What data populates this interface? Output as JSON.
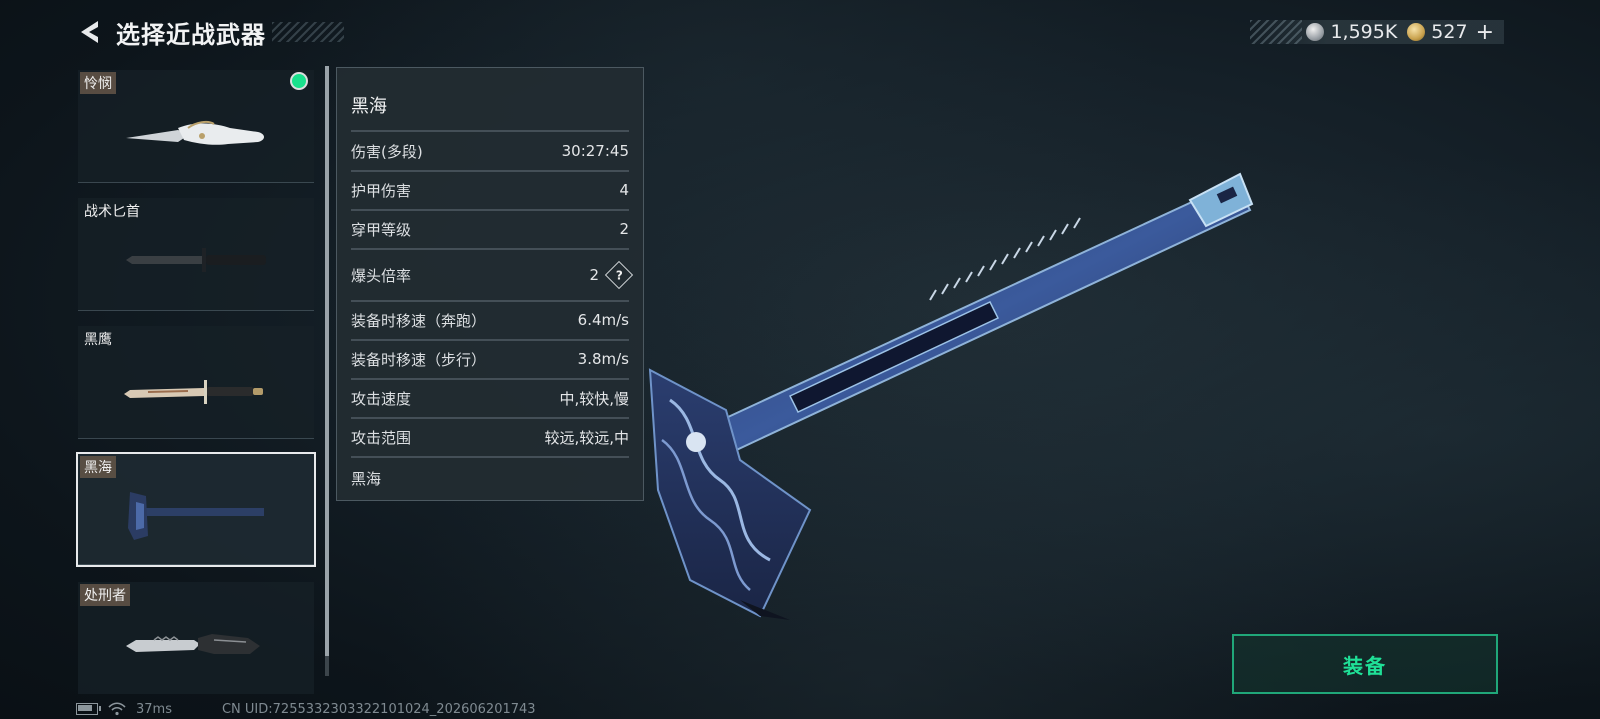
{
  "header": {
    "title": "选择近战武器",
    "back_icon": "back-arrow-icon"
  },
  "currency": {
    "silver": "1,595K",
    "gold": "527",
    "plus": "+"
  },
  "weapons": [
    {
      "name": "怜悯",
      "equipped": true,
      "selected": false
    },
    {
      "name": "战术匕首",
      "equipped": false,
      "selected": false
    },
    {
      "name": "黑鹰",
      "equipped": false,
      "selected": false
    },
    {
      "name": "黑海",
      "equipped": false,
      "selected": true
    },
    {
      "name": "处刑者",
      "equipped": false,
      "selected": false
    }
  ],
  "stats": {
    "title": "黑海",
    "rows": [
      {
        "label": "伤害(多段)",
        "value": "30:27:45"
      },
      {
        "label": "护甲伤害",
        "value": "4"
      },
      {
        "label": "穿甲等级",
        "value": "2"
      },
      {
        "label": "爆头倍率",
        "value": "2"
      },
      {
        "label": "装备时移速（奔跑）",
        "value": "6.4m/s"
      },
      {
        "label": "装备时移速（步行）",
        "value": "3.8m/s"
      },
      {
        "label": "攻击速度",
        "value": "中,较快,慢"
      },
      {
        "label": "攻击范围",
        "value": "较远,较远,中"
      }
    ],
    "help_symbol": "?",
    "footer": "黑海"
  },
  "equip_button": {
    "label": "装备"
  },
  "status_bar": {
    "ping": "37ms",
    "uid": "CN UID:7255332303322101024_202606201743"
  },
  "colors": {
    "accent_green": "#1fe097",
    "equipped_dot": "#19e08c"
  }
}
